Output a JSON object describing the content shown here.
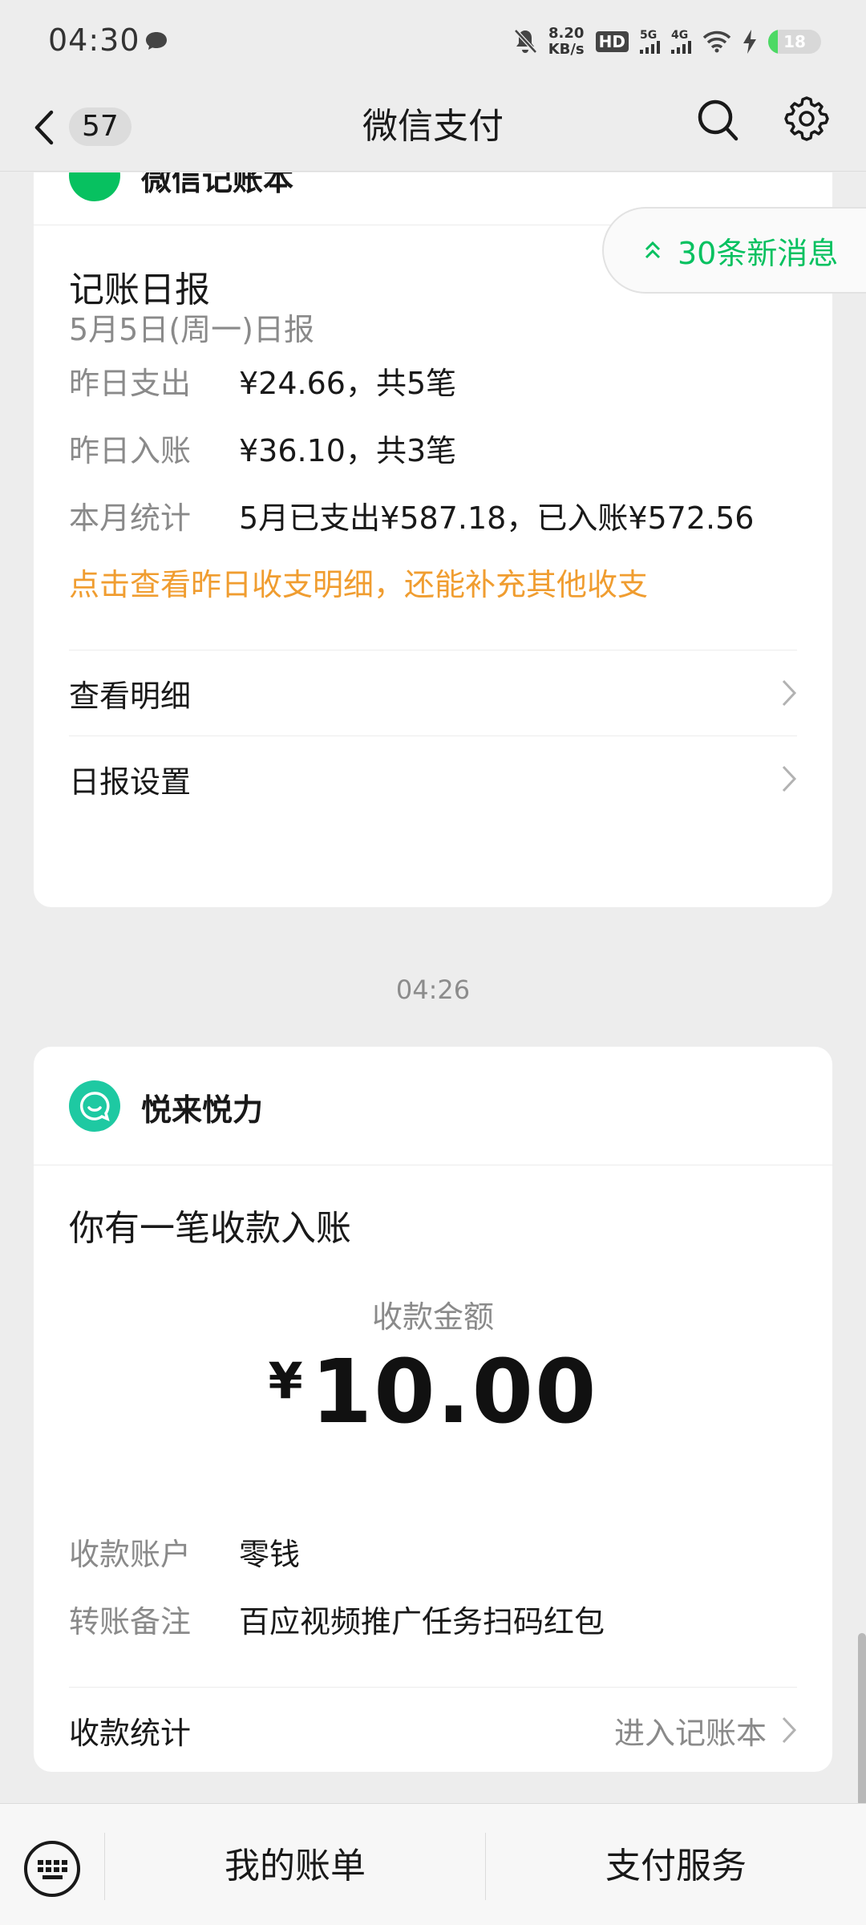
{
  "status_bar": {
    "time": "04:30",
    "net_speed_value": "8.20",
    "net_speed_unit": "KB/s",
    "hd": "HD",
    "net1": "5G",
    "net2": "4G",
    "battery": "18"
  },
  "nav": {
    "unread_count": "57",
    "title": "微信支付"
  },
  "new_messages": "30条新消息",
  "card1": {
    "source_name": "微信记账本",
    "title": "记账日报",
    "subtitle": "5月5日(周一)日报",
    "rows": [
      {
        "label": "昨日支出",
        "value": "¥24.66，共5笔"
      },
      {
        "label": "昨日入账",
        "value": "¥36.10，共3笔"
      },
      {
        "label": "本月统计",
        "value": "5月已支出¥587.18，已入账¥572.56"
      }
    ],
    "link": "点击查看昨日收支明细，还能补充其他收支",
    "menu": [
      "查看明细",
      "日报设置"
    ]
  },
  "timestamp": "04:26",
  "card2": {
    "source_name": "悦来悦力",
    "title": "你有一笔收款入账",
    "amount_label": "收款金额",
    "currency": "¥",
    "amount": "10.00",
    "rows": [
      {
        "label": "收款账户",
        "value": "零钱"
      },
      {
        "label": "转账备注",
        "value": "百应视频推广任务扫码红包"
      }
    ],
    "stat_label": "收款统计",
    "stat_link": "进入记账本"
  },
  "bottom_bar": {
    "left": "我的账单",
    "right": "支付服务"
  },
  "colors": {
    "accent_green": "#07c160",
    "orange_link": "#f09d30",
    "teal_logo": "#1ec9a2"
  }
}
